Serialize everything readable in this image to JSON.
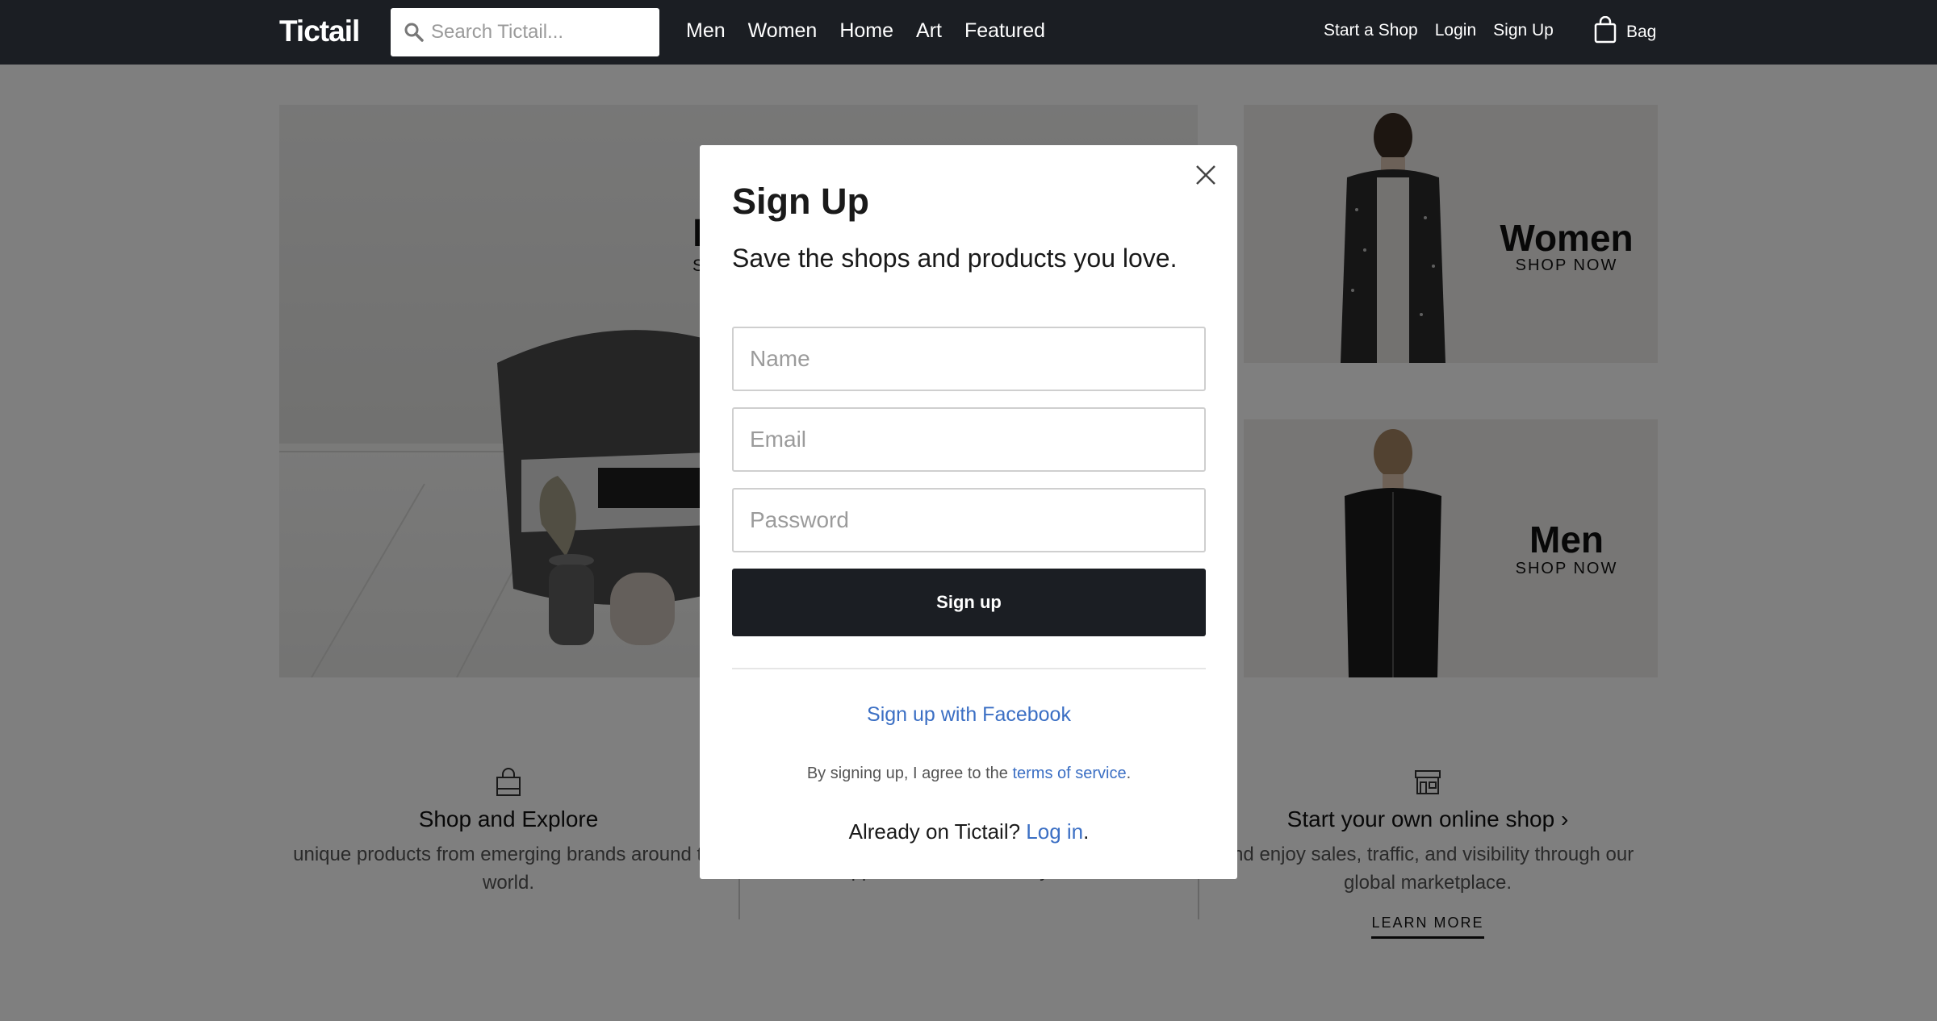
{
  "header": {
    "logo": "Tictail",
    "search_placeholder": "Search Tictail...",
    "nav": [
      "Men",
      "Women",
      "Home",
      "Art",
      "Featured"
    ],
    "right_links": [
      "Start a Shop",
      "Login",
      "Sign Up"
    ],
    "bag_label": "Bag"
  },
  "hero": {
    "left_title": "H",
    "left_sub": "S",
    "women": {
      "title": "Women",
      "cta": "SHOP NOW"
    },
    "men": {
      "title": "Men",
      "cta": "SHOP NOW"
    }
  },
  "features": [
    {
      "icon": "shopping-bag-icon",
      "title": "Shop and Explore",
      "text": "unique products from emerging brands around the world."
    },
    {
      "icon": "",
      "title": "",
      "text": "shoppers and the brands you love."
    },
    {
      "icon": "storefront-icon",
      "title": "Start your own online shop ›",
      "text": "and enjoy sales, traffic, and visibility through our global marketplace.",
      "link": "LEARN MORE"
    }
  ],
  "modal": {
    "title": "Sign Up",
    "tagline": "Save the shops and products you love.",
    "name_placeholder": "Name",
    "email_placeholder": "Email",
    "password_placeholder": "Password",
    "submit_label": "Sign up",
    "facebook_label": "Sign up with Facebook",
    "terms_prefix": "By signing up, I agree to the ",
    "terms_link": "terms of service",
    "terms_suffix": ".",
    "already_prefix": "Already on Tictail? ",
    "login_link": "Log in",
    "already_suffix": "."
  },
  "colors": {
    "nav_bg": "#1b1e23",
    "link_blue": "#3b6fc4",
    "button_bg": "#1b1e23",
    "overlay": "rgba(0,0,0,0.5)"
  }
}
